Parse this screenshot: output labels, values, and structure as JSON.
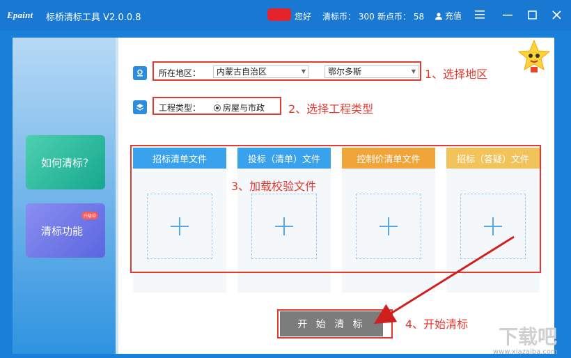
{
  "titlebar": {
    "logo": "Epaint",
    "app_title": "标桥清标工具 V2.0.0.8",
    "greeting": "您好",
    "coin_label": "清标币：",
    "coin_value": "300",
    "new_coin_label": "新点币：",
    "new_coin_value": "58",
    "recharge_label": "充值"
  },
  "sidebar": {
    "how_label": "如何清标？",
    "function_label": "清标功能",
    "new_tag": "升级中"
  },
  "region": {
    "label": "所在地区：",
    "province": "内蒙古自治区",
    "city": "鄂尔多斯"
  },
  "project_type": {
    "label": "工程类型：",
    "option": "房屋与市政"
  },
  "cards": [
    {
      "title": "招标清单文件",
      "color": "#3aa2ec"
    },
    {
      "title": "投标（清单）文件",
      "color": "#3aa2ec"
    },
    {
      "title": "控制价清单文件",
      "color": "#f0a53a"
    },
    {
      "title": "招标（答疑）文件",
      "color": "#f2c35a"
    }
  ],
  "start_button": "开 始 清 标",
  "annotations": {
    "step1": "1、选择地区",
    "step2": "2、选择工程类型",
    "step3": "3、加载校验文件",
    "step4": "4、开始清标"
  },
  "watermark": "下载吧",
  "watermark_url": "www.xiazaiba.com",
  "colors": {
    "titlebar": "#1878d2",
    "annotation_red": "#e23a30",
    "button_gray": "#7c7c7c"
  }
}
